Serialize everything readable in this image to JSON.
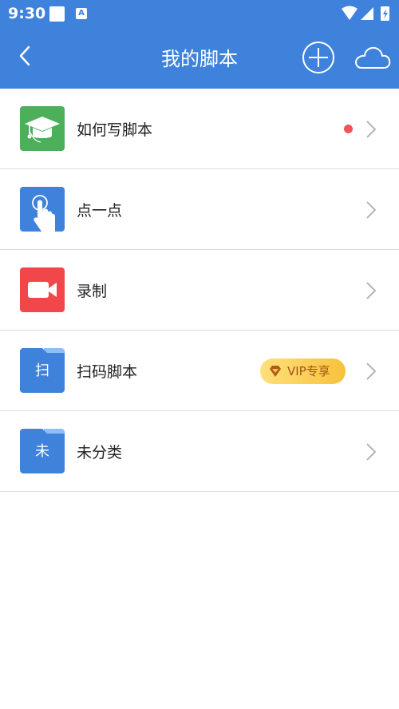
{
  "status_bar": {
    "time": "9:30",
    "a_badge": "A",
    "icons": [
      "notification-square-icon",
      "a-app-icon",
      "wifi-icon",
      "signal-icon",
      "battery-charging-icon"
    ]
  },
  "app_bar": {
    "title": "我的脚本",
    "back_icon": "chevron-left-icon",
    "add_icon": "plus-circle-icon",
    "cloud_icon": "cloud-icon"
  },
  "colors": {
    "primary": "#3f82db",
    "green": "#4caf5a",
    "blue": "#3f82db",
    "red": "#f2474a",
    "dot": "#f05555",
    "vip_gold": "#f7c23c",
    "vip_text": "#a0551e"
  },
  "items": [
    {
      "label": "如何写脚本",
      "icon": "graduation-cap-icon",
      "has_dot": true
    },
    {
      "label": "点一点",
      "icon": "tap-finger-icon"
    },
    {
      "label": "录制",
      "icon": "video-camera-icon"
    },
    {
      "label": "扫码脚本",
      "icon": "folder-icon",
      "folder_letter": "扫",
      "badge": "VIP专享",
      "badge_icon": "diamond-icon"
    },
    {
      "label": "未分类",
      "icon": "folder-icon",
      "folder_letter": "未"
    }
  ]
}
